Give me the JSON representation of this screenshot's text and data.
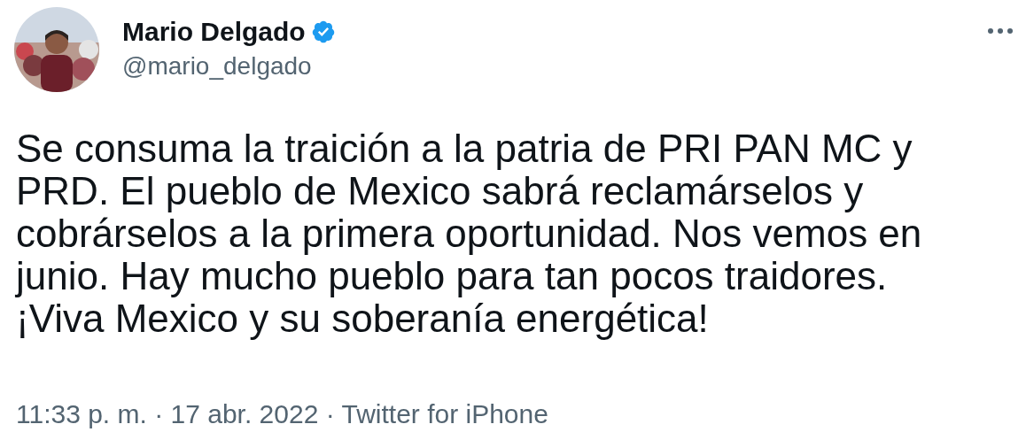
{
  "author": {
    "name": "Mario Delgado",
    "handle": "@mario_delgado",
    "verified": true
  },
  "tweet": {
    "lines": [
      "Se consuma la traición a la patria de PRI PAN MC y",
      "PRD. El pueblo de Mexico sabrá reclamárselos y",
      "cobrárselos a la primera oportunidad. Nos vemos en",
      "junio. Hay mucho pueblo para tan pocos traidores.",
      "¡Viva Mexico y su soberanía energética!"
    ]
  },
  "footer": "11:33 p. m. · 17 abr. 2022 · Twitter for iPhone"
}
